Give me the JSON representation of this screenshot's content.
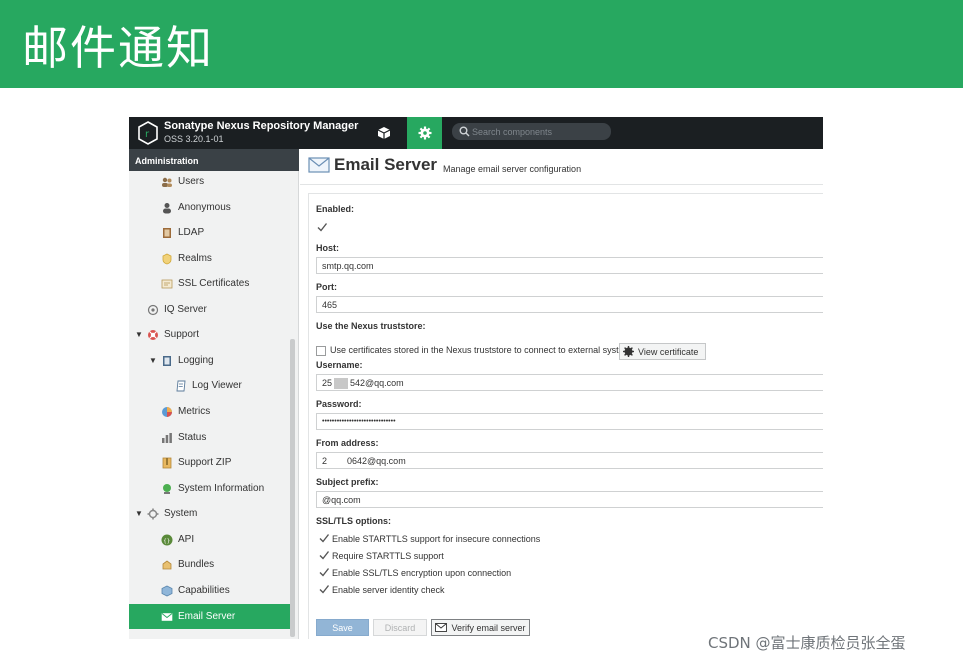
{
  "banner": {
    "title": "邮件通知"
  },
  "watermark": "CSDN @富士康质检员张全蛋",
  "app": {
    "name": "Sonatype Nexus Repository Manager",
    "version": "OSS 3.20.1-01"
  },
  "search": {
    "placeholder": "Search components"
  },
  "sidebar": {
    "header": "Administration",
    "items": [
      {
        "label": "Users",
        "icon": "users-icon"
      },
      {
        "label": "Anonymous",
        "icon": "anonymous-icon"
      },
      {
        "label": "LDAP",
        "icon": "ldap-icon"
      },
      {
        "label": "Realms",
        "icon": "realms-icon"
      },
      {
        "label": "SSL Certificates",
        "icon": "certificate-icon"
      },
      {
        "label": "IQ Server",
        "icon": "iq-server-icon"
      },
      {
        "label": "Support",
        "icon": "support-icon"
      },
      {
        "label": "Logging",
        "icon": "logging-icon"
      },
      {
        "label": "Log Viewer",
        "icon": "log-viewer-icon"
      },
      {
        "label": "Metrics",
        "icon": "metrics-icon"
      },
      {
        "label": "Status",
        "icon": "status-icon"
      },
      {
        "label": "Support ZIP",
        "icon": "support-zip-icon"
      },
      {
        "label": "System Information",
        "icon": "system-information-icon"
      },
      {
        "label": "System",
        "icon": "system-icon"
      },
      {
        "label": "API",
        "icon": "api-icon"
      },
      {
        "label": "Bundles",
        "icon": "bundles-icon"
      },
      {
        "label": "Capabilities",
        "icon": "capabilities-icon"
      },
      {
        "label": "Email Server",
        "icon": "email-icon"
      }
    ]
  },
  "page": {
    "title": "Email Server",
    "subtitle": "Manage email server configuration"
  },
  "form": {
    "enabled_label": "Enabled:",
    "host_label": "Host:",
    "host_value": "smtp.qq.com",
    "port_label": "Port:",
    "port_value": "465",
    "truststore_label": "Use the Nexus truststore:",
    "truststore_text": "Use certificates stored in the Nexus truststore to connect to external systems",
    "view_certificate": "View certificate",
    "username_label": "Username:",
    "username_prefix": "25",
    "username_suffix": "542@qq.com",
    "password_label": "Password:",
    "password_value": "••••••••••••••••••••••••••••••",
    "from_label": "From address:",
    "from_prefix": "2",
    "from_suffix": "0642@qq.com",
    "subject_label": "Subject prefix:",
    "subject_value": "@qq.com",
    "ssl_label": "SSL/TLS options:",
    "ssl_options": [
      "Enable STARTTLS support for insecure connections",
      "Require STARTTLS support",
      "Enable SSL/TLS encryption upon connection",
      "Enable server identity check"
    ]
  },
  "buttons": {
    "save": "Save",
    "discard": "Discard",
    "verify": "Verify email server"
  },
  "colors": {
    "banner": "#27a860",
    "topbar": "#1b1f22",
    "accent": "#27a860",
    "save": "#92b5d6"
  }
}
